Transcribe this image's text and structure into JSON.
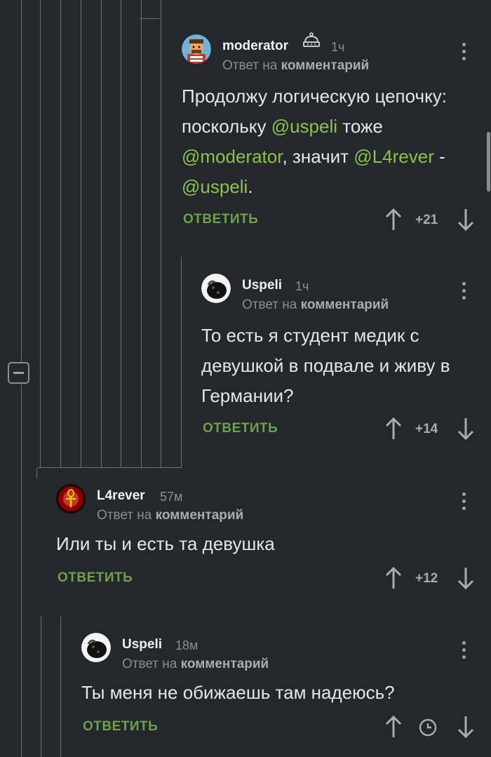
{
  "comments": [
    {
      "username": "moderator",
      "time": "1ч",
      "reply_prefix": "Ответ на",
      "reply_target": "комментарий",
      "text_before": "Продолжу логическую цепочку: поскольку ",
      "mention1": "@uspeli",
      "text_mid1": " тоже ",
      "mention2": "@moderator",
      "text_mid2": ", значит ",
      "mention3": "@L4rever",
      "text_mid3": " - ",
      "mention4": "@uspeli",
      "text_end": ".",
      "reply_label": "ОТВЕТИТЬ",
      "score": "+21"
    },
    {
      "username": "Uspeli",
      "time": "1ч",
      "reply_prefix": "Ответ на",
      "reply_target": "комментарий",
      "text": "То есть я студент медик с девушкой в подвале и живу в Германии?",
      "reply_label": "ОТВЕТИТЬ",
      "score": "+14"
    },
    {
      "username": "L4rever",
      "time": "57м",
      "reply_prefix": "Ответ на",
      "reply_target": "комментарий",
      "text": "Или ты и есть та девушка",
      "reply_label": "ОТВЕТИТЬ",
      "score": "+12"
    },
    {
      "username": "Uspeli",
      "time": "18м",
      "reply_prefix": "Ответ на",
      "reply_target": "комментарий",
      "text": "Ты меня не обижаешь там надеюсь?",
      "reply_label": "ОТВЕТИТЬ",
      "score_icon": "clock-icon"
    }
  ],
  "colors": {
    "background": "#24272b",
    "mention": "#8bc34a",
    "reply": "#6ea24a",
    "muted": "#8a8e93"
  }
}
